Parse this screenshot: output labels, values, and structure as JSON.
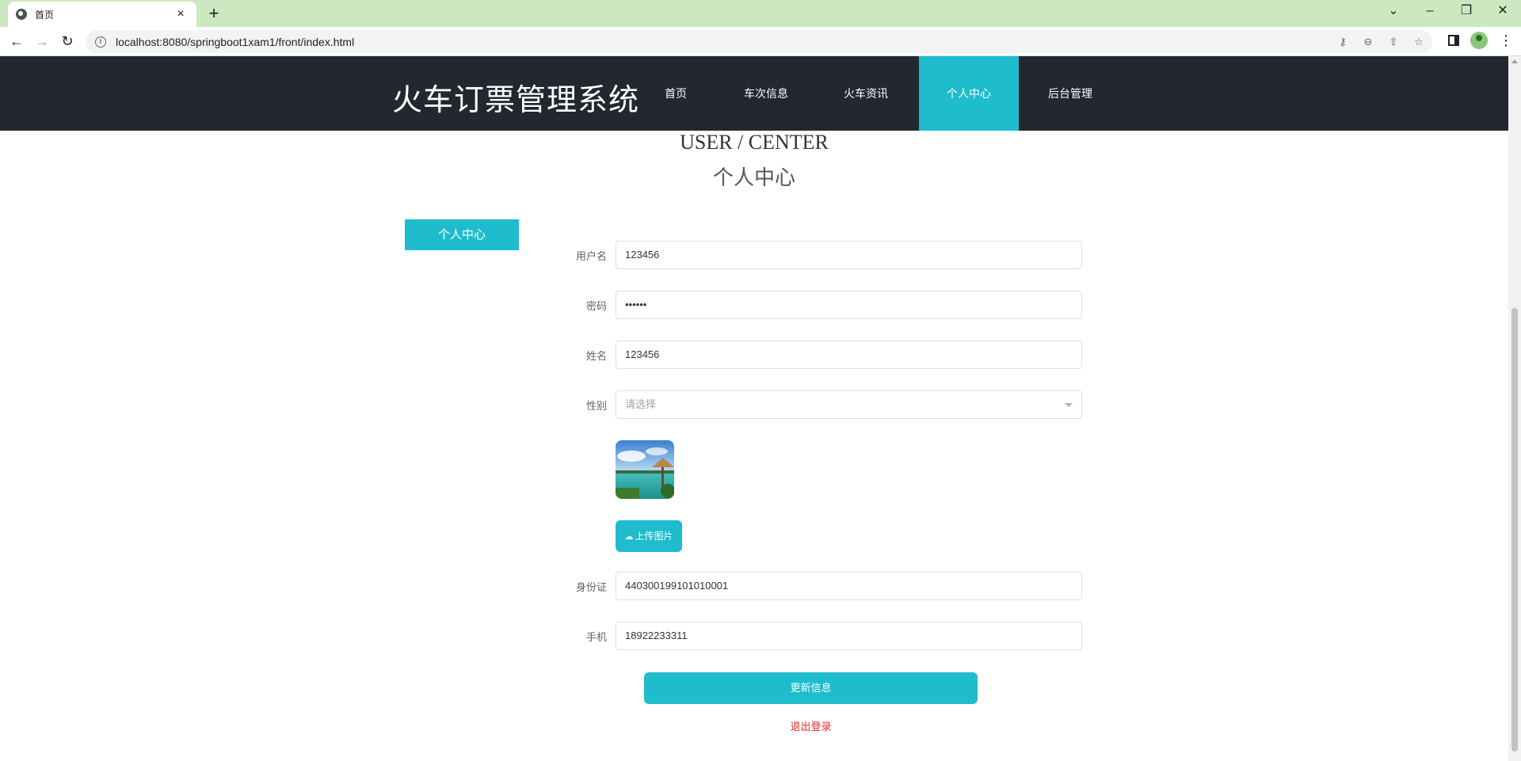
{
  "browser": {
    "tab_title": "首页",
    "url": "localhost:8080/springboot1xam1/front/index.html"
  },
  "site": {
    "brand": "火车订票管理系统",
    "nav": [
      "首页",
      "车次信息",
      "火车资讯",
      "个人中心",
      "后台管理"
    ],
    "active_nav": "个人中心"
  },
  "page": {
    "heading_en": "USER / CENTER",
    "heading_cn": "个人中心",
    "side_tab": "个人中心"
  },
  "form": {
    "username_label": "用户名",
    "username_value": "123456",
    "password_label": "密码",
    "password_value": "••••••",
    "name_label": "姓名",
    "name_value": "123456",
    "gender_label": "性别",
    "gender_placeholder": "请选择",
    "upload_label": "上传图片",
    "idcard_label": "身份证",
    "idcard_value": "440300199101010001",
    "phone_label": "手机",
    "phone_value": "18922233311",
    "submit_label": "更新信息",
    "logout_label": "退出登录"
  },
  "colors": {
    "accent": "#1ebccc",
    "navbar": "#23272f",
    "logout": "#e62b2b"
  }
}
